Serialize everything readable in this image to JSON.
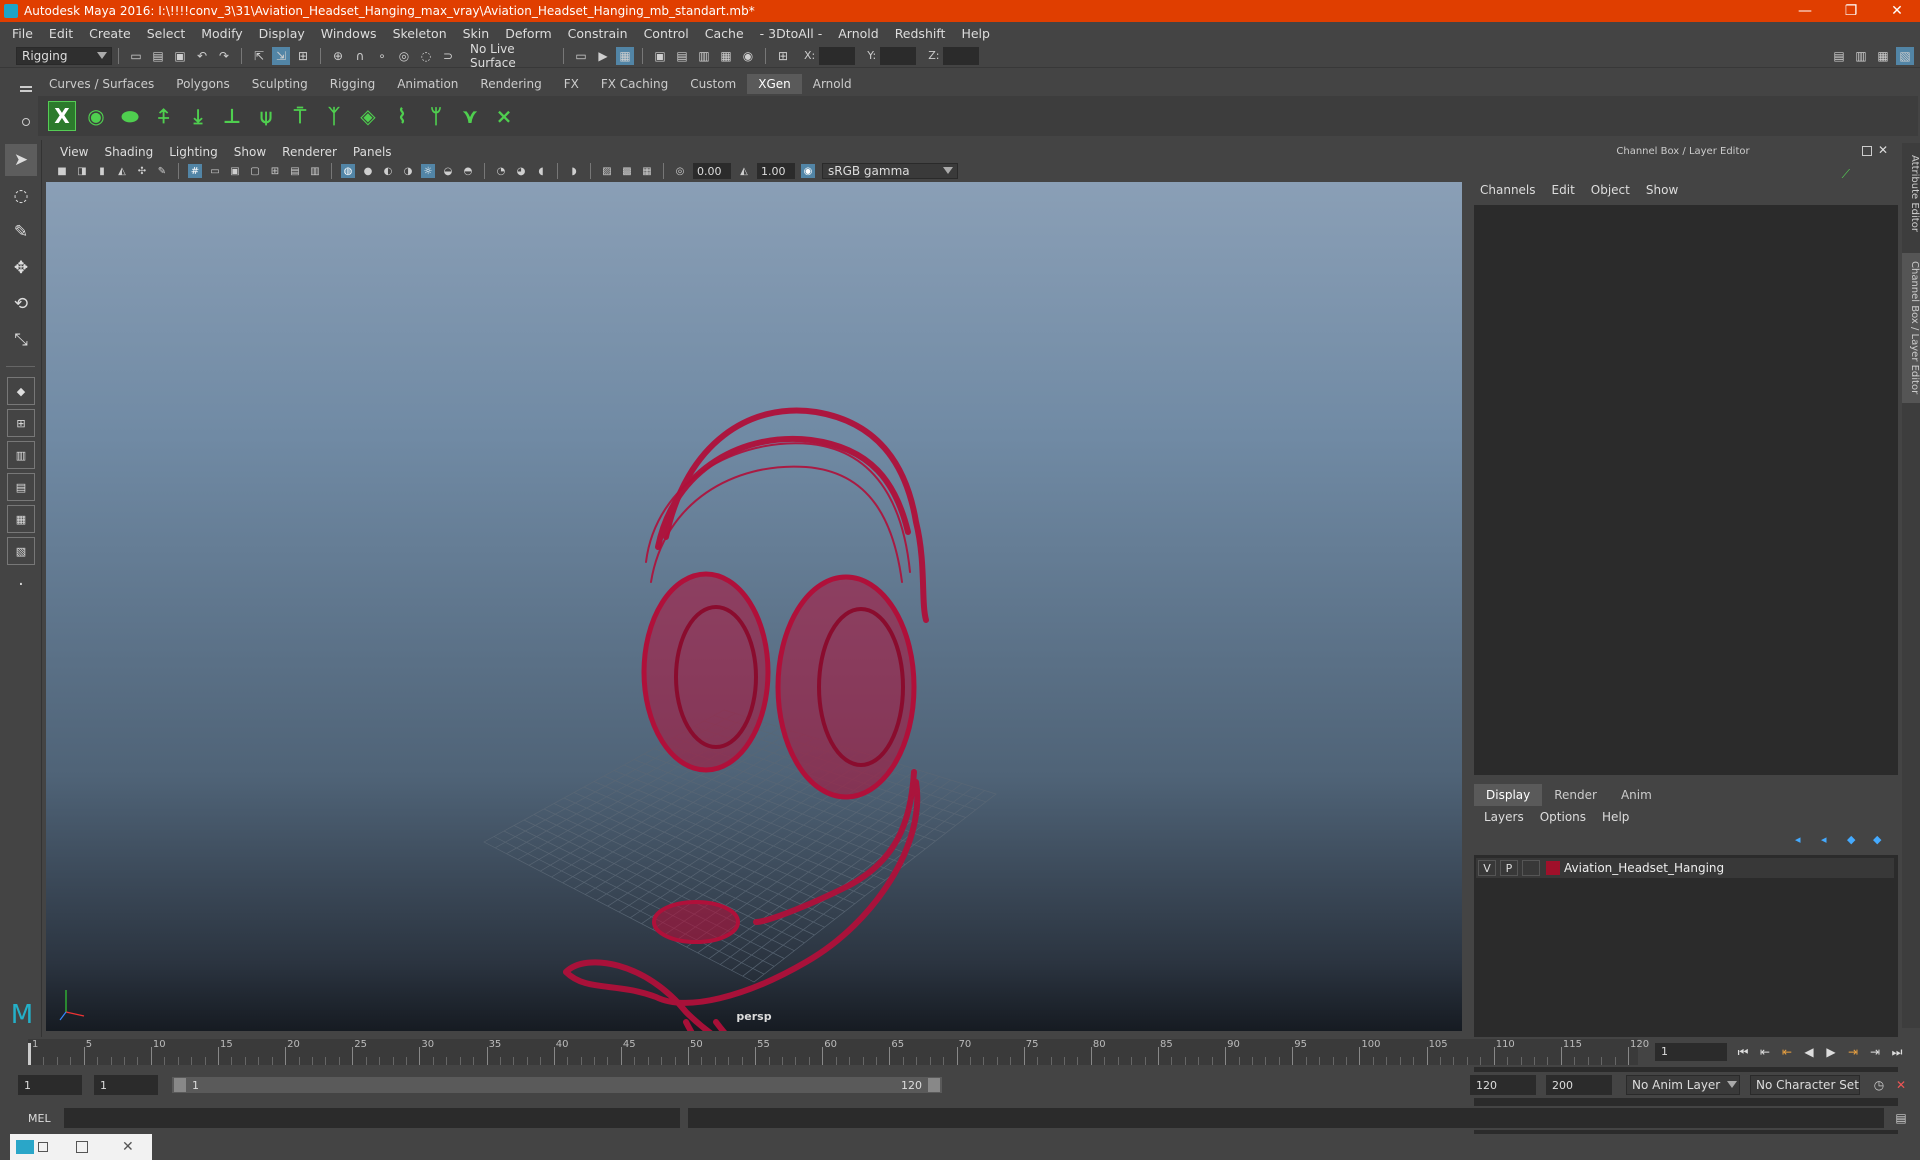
{
  "window": {
    "title": "Autodesk Maya 2016: I:\\!!!!conv_3\\31\\Aviation_Headset_Hanging_max_vray\\Aviation_Headset_Hanging_mb_standart.mb*",
    "minimize": "—",
    "restore": "❐",
    "close": "✕"
  },
  "menu": [
    "File",
    "Edit",
    "Create",
    "Select",
    "Modify",
    "Display",
    "Windows",
    "Skeleton",
    "Skin",
    "Deform",
    "Constrain",
    "Control",
    "Cache",
    "- 3DtoAll -",
    "Arnold",
    "Redshift",
    "Help"
  ],
  "status_line": {
    "mode": "Rigging",
    "live_surface": "No Live Surface",
    "x_label": "X:",
    "y_label": "Y:",
    "z_label": "Z:"
  },
  "shelf_tabs": [
    {
      "label": "Curves / Surfaces",
      "active": false
    },
    {
      "label": "Polygons",
      "active": false
    },
    {
      "label": "Sculpting",
      "active": false
    },
    {
      "label": "Rigging",
      "active": false
    },
    {
      "label": "Animation",
      "active": false
    },
    {
      "label": "Rendering",
      "active": false
    },
    {
      "label": "FX",
      "active": false
    },
    {
      "label": "FX Caching",
      "active": false
    },
    {
      "label": "Custom",
      "active": false
    },
    {
      "label": "XGen",
      "active": true
    },
    {
      "label": "Arnold",
      "active": false
    }
  ],
  "panel_menu": [
    "View",
    "Shading",
    "Lighting",
    "Show",
    "Renderer",
    "Panels"
  ],
  "view_tools": {
    "exposure": "0.00",
    "gamma": "1.00",
    "color_space": "sRGB gamma"
  },
  "viewport": {
    "camera": "persp",
    "model_color": "#b0103a"
  },
  "channel_box": {
    "title": "Channel Box / Layer Editor",
    "menu": [
      "Channels",
      "Edit",
      "Object",
      "Show"
    ]
  },
  "layer_editor": {
    "tabs": [
      {
        "label": "Display",
        "active": true
      },
      {
        "label": "Render",
        "active": false
      },
      {
        "label": "Anim",
        "active": false
      }
    ],
    "menu": [
      "Layers",
      "Options",
      "Help"
    ],
    "layers": [
      {
        "v": "V",
        "p": "P",
        "name": "Aviation_Headset_Hanging",
        "color": "#a0102a"
      }
    ]
  },
  "side_tabs": [
    "Attribute Editor",
    "Channel Box / Layer Editor"
  ],
  "timeline": {
    "labels": [
      "1",
      "5",
      "10",
      "15",
      "20",
      "25",
      "30",
      "35",
      "40",
      "45",
      "50",
      "55",
      "60",
      "65",
      "70",
      "75",
      "80",
      "85",
      "90",
      "95",
      "100",
      "105",
      "110",
      "115",
      "120"
    ],
    "current_frame": "1"
  },
  "range": {
    "start": "1",
    "playback_start": "1",
    "slider_start": "1",
    "slider_end": "120",
    "playback_end": "120",
    "end": "200",
    "anim_layer": "No Anim Layer",
    "character_set": "No Character Set"
  },
  "command_line": {
    "label": "MEL"
  }
}
